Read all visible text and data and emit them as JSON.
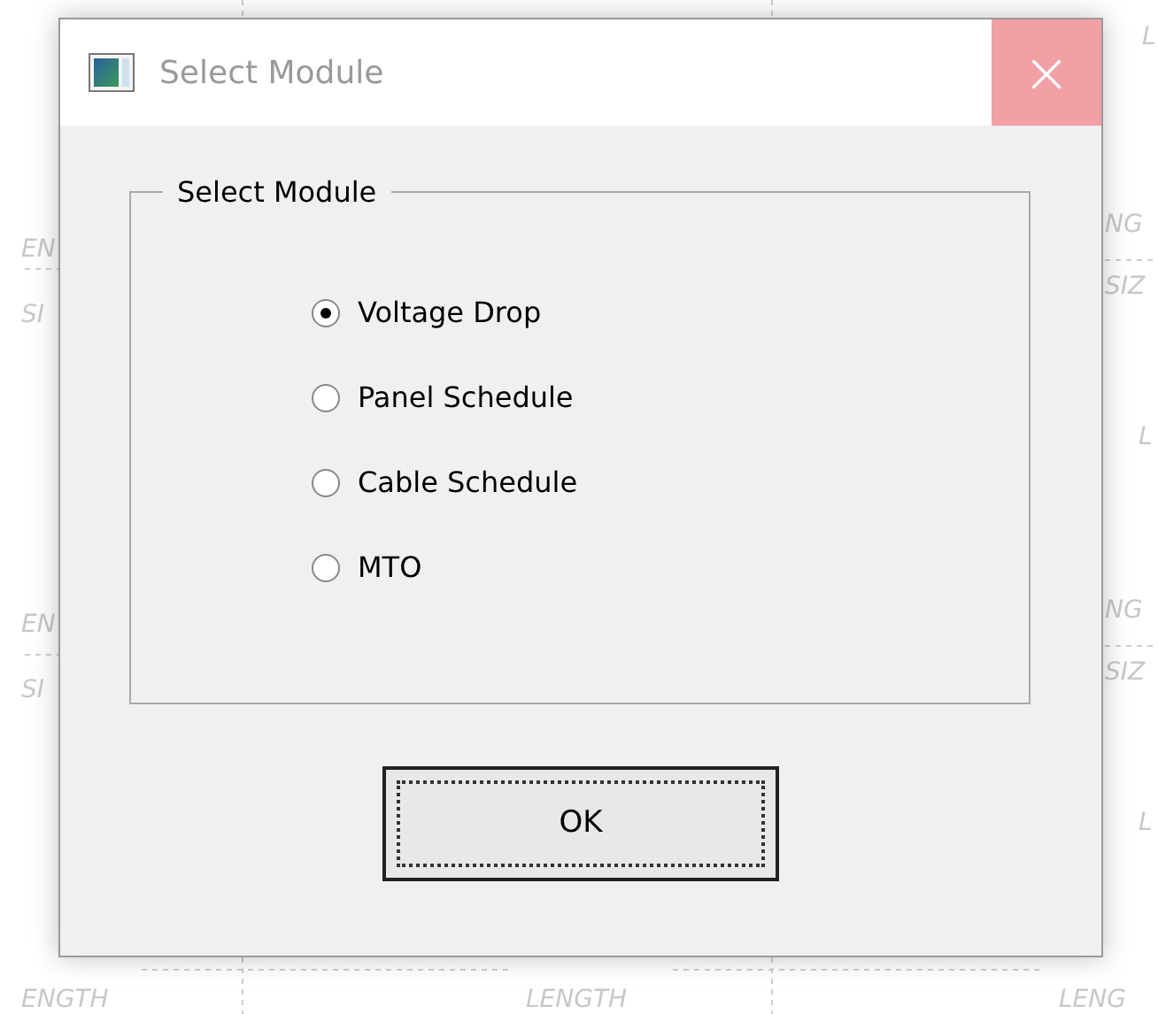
{
  "drawing_labels_left": [
    "EN",
    "SI",
    "EN",
    "SI"
  ],
  "drawing_labels_right": [
    "L",
    "NG",
    "SIZ",
    "L",
    "NG",
    "SIZ",
    "L"
  ],
  "drawing_labels_bottom": [
    "ENGTH",
    "LENGTH",
    "LENG"
  ],
  "window": {
    "title": "Select Module",
    "close": "×"
  },
  "group": {
    "title": "Select Module",
    "options": [
      {
        "label": "Voltage Drop",
        "selected": true
      },
      {
        "label": "Panel Schedule",
        "selected": false
      },
      {
        "label": "Cable Schedule",
        "selected": false
      },
      {
        "label": "MTO",
        "selected": false
      }
    ]
  },
  "buttons": [
    {
      "label": "OK",
      "focused": true
    }
  ]
}
